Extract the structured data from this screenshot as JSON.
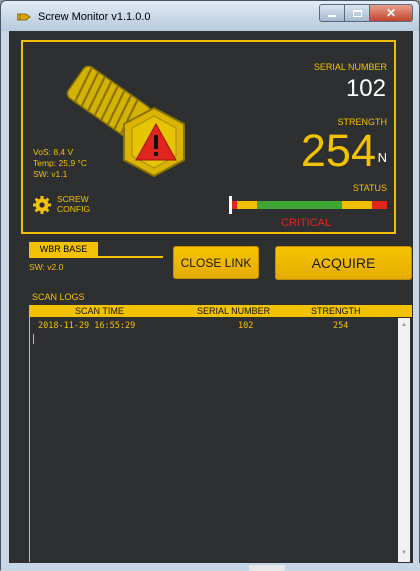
{
  "window": {
    "title": "Screw Monitor v1.1.0.0",
    "minimize_icon": "minimize-icon",
    "maximize_icon": "maximize-icon",
    "close_icon": "close-icon",
    "close_glyph": "✕"
  },
  "device": {
    "icon": "bolt-warning-icon",
    "vos": "VoS: 8,4 V",
    "temp": "Temp: 25,9 °C",
    "sw": "SW: v1.1",
    "config_label_1": "SCREW",
    "config_label_2": "CONFIG",
    "serial_label": "SERIAL NUMBER",
    "serial_value": "102",
    "strength_label": "STRENGTH",
    "strength_value": "254",
    "strength_unit": "N",
    "status_label": "STATUS",
    "status_value": "CRITICAL",
    "gauge_level": 0.0
  },
  "base": {
    "label": "WBR BASE",
    "sw": "SW: v2.0"
  },
  "buttons": {
    "close_link": "CLOSE LINK",
    "acquire": "ACQUIRE"
  },
  "logs": {
    "title": "SCAN LOGS",
    "columns": [
      "SCAN TIME",
      "SERIAL NUMBER",
      "STRENGTH"
    ],
    "rows": [
      {
        "scan_time": "2018-11-29 16:55:29",
        "serial": "102",
        "strength": "254"
      }
    ]
  },
  "colors": {
    "accent": "#f2c200",
    "background": "#2e2f31",
    "critical": "#e02626",
    "ok": "#3fa535"
  }
}
